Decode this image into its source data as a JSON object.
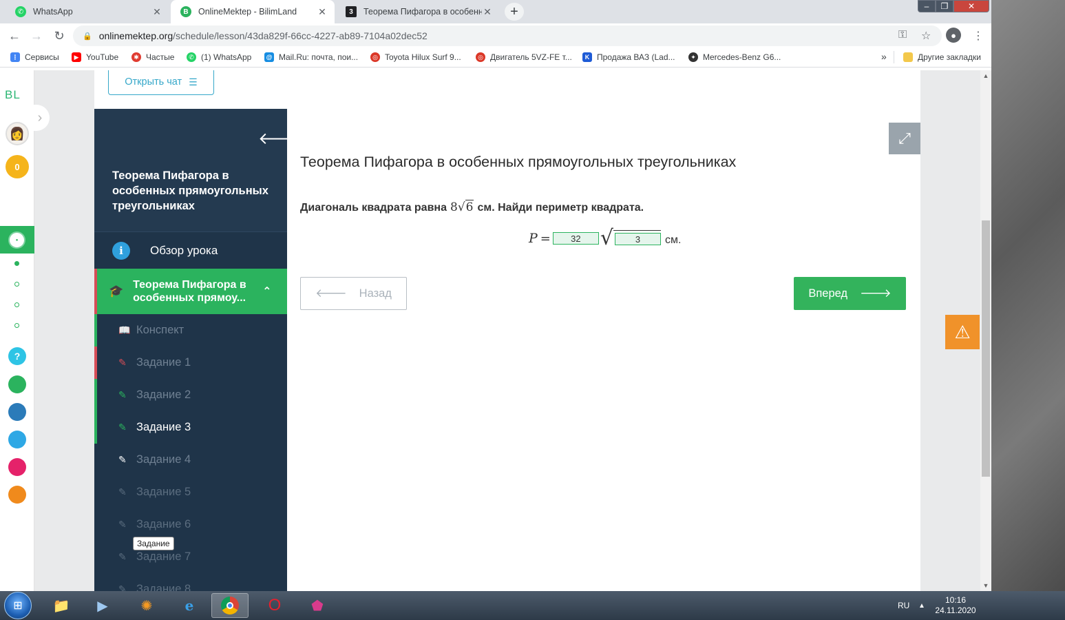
{
  "browser": {
    "tabs": [
      {
        "title": "WhatsApp",
        "icon": "whatsapp-icon",
        "color": "#25d366",
        "active": false
      },
      {
        "title": "OnlineMektep - BilimLand",
        "icon": "bilimland-icon",
        "color": "#2bb35e",
        "active": true
      },
      {
        "title": "Теорема Пифагора в особенных",
        "icon": "z-icon",
        "color": "#202124",
        "active": false
      }
    ],
    "url": {
      "host": "onlinemektep.org",
      "path": "/schedule/lesson/43da829f-66cc-4227-ab89-7104a02dec52"
    },
    "bookmarks": [
      {
        "label": "Сервисы",
        "icon": "apps-grid-icon",
        "color": "#4285f4"
      },
      {
        "label": "YouTube",
        "icon": "youtube-icon",
        "color": "#ff0000"
      },
      {
        "label": "Частые",
        "icon": "frequent-icon",
        "color": "#e03c31"
      },
      {
        "label": "(1) WhatsApp",
        "icon": "whatsapp-icon",
        "color": "#25d366"
      },
      {
        "label": "Mail.Ru: почта, пои...",
        "icon": "mailru-icon",
        "color": "#168de2"
      },
      {
        "label": "Toyota Hilux Surf 9...",
        "icon": "drom-icon",
        "color": "#db3727"
      },
      {
        "label": "Двигатель 5VZ-FE т...",
        "icon": "drom-icon",
        "color": "#db3727"
      },
      {
        "label": "Продажа ВАЗ (Lad...",
        "icon": "kolesa-icon",
        "color": "#1e5bd6"
      },
      {
        "label": "Mercedes-Benz G6...",
        "icon": "mercedes-icon",
        "color": "#333333"
      }
    ],
    "bookmarks_more": "»",
    "other_bookmarks": "Другие закладки"
  },
  "rail": {
    "logo": "BL",
    "score": "0",
    "help": "?"
  },
  "lesson": {
    "open_chat": "Открыть чат",
    "sidebar_title": "Теорема Пифагора в особенных прямоугольных треугольниках",
    "overview": "Обзор урока",
    "topic": "Теорема Пифагора в особенных прямоу...",
    "items": [
      {
        "label": "Конспект",
        "state": "done"
      },
      {
        "label": "Задание 1",
        "state": "wrong"
      },
      {
        "label": "Задание 2",
        "state": "done"
      },
      {
        "label": "Задание 3",
        "state": "current"
      },
      {
        "label": "Задание 4",
        "state": "pending"
      },
      {
        "label": "Задание 5",
        "state": "locked"
      },
      {
        "label": "Задание 6",
        "state": "locked"
      },
      {
        "label": "Задание 7",
        "state": "locked"
      },
      {
        "label": "Задание 8",
        "state": "locked"
      }
    ],
    "tooltip": "Задание",
    "title": "Теорема Пифагора в особенных прямоугольных треугольниках",
    "question_prefix": "Диагональ квадрата равна",
    "question_coef": "8",
    "question_radicand": "6",
    "question_suffix": "см. Найди периметр квадрата.",
    "formula_var": "P",
    "formula_eq": "=",
    "answer_coef": "32",
    "answer_radicand": "3",
    "unit": "см.",
    "back_label": "Назад",
    "next_label": "Вперед",
    "colors": {
      "accent_green": "#33b35c",
      "sidebar": "#1f3449",
      "wrong_red": "#d64d57",
      "warning": "#f0922a",
      "chat_blue": "#35a7c9"
    }
  },
  "taskbar": {
    "lang": "RU",
    "time": "10:16",
    "date": "24.11.2020"
  }
}
